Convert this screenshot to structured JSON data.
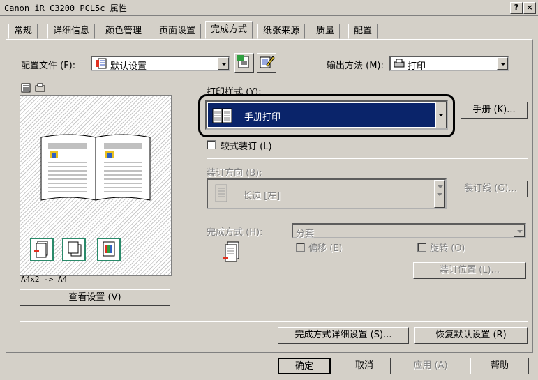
{
  "window": {
    "title": "Canon iR C3200 PCL5c 属性",
    "help_button": "?",
    "close_button": "×"
  },
  "tabs": [
    "常规",
    "详细信息",
    "颜色管理",
    "页面设置",
    "完成方式",
    "纸张来源",
    "质量",
    "配置"
  ],
  "active_tab": "完成方式",
  "profile": {
    "label": "配置文件 (F):",
    "value": "默认设置"
  },
  "output_method": {
    "label": "输出方法 (M):",
    "value": "打印"
  },
  "print_style": {
    "label": "打印样式 (Y):",
    "value": "手册打印",
    "booklet_button": "手册 (K)..."
  },
  "soft_binding": {
    "label": "较式装订 (L)"
  },
  "binding_direction": {
    "label": "装订方向 (B):",
    "value": "长边 [左]",
    "gutter_button": "装订线 (G)..."
  },
  "finishing": {
    "label": "完成方式 (H):",
    "value": "分套",
    "offset_label": "偏移 (E)",
    "rotate_label": "旋转 (O)",
    "binding_position_button": "装订位置 (L)..."
  },
  "preview": {
    "caption": "A4x2 -> A4",
    "view_settings_button": "查看设置 (V)"
  },
  "bottom_buttons": {
    "finishing_details": "完成方式详细设置 (S)...",
    "restore_defaults": "恢复默认设置 (R)"
  },
  "dialog_buttons": {
    "ok": "确定",
    "cancel": "取消",
    "apply": "应用 (A)",
    "help": "帮助"
  },
  "colors": {
    "selection": "#0a246a",
    "face": "#d4d0c8",
    "highlight_ring": "#000000"
  }
}
